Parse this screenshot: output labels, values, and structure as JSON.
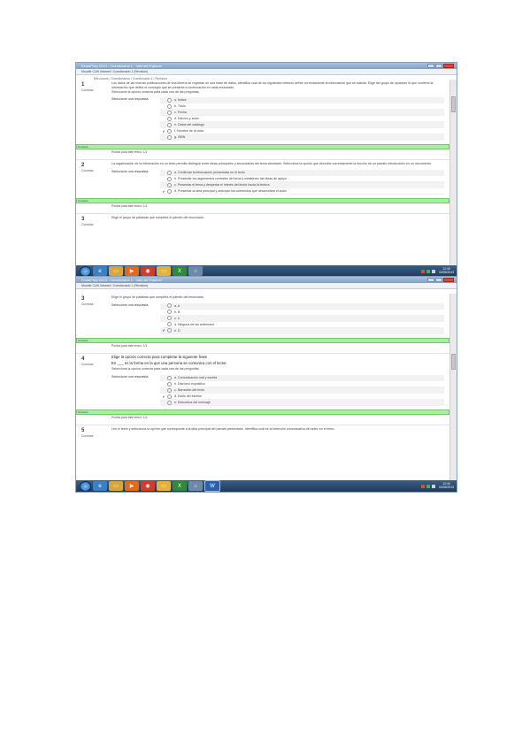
{
  "screens": [
    {
      "window_title": "ExamPrep 2013 - Cuestionario 1 - Internet Explorer",
      "address": "Moodle CUN Intranet / Cuestionario 1 (Revisión)",
      "breadcrumb": "Mis cursos / Cuestionarios / Cuestionario 1 / Revisión",
      "scroll": 0.1,
      "questions": [
        {
          "number": "1",
          "status": "Correcta",
          "text": "Los datos de las nuevas publicaciones de una librería se registran en una base de datos, identifica cuál de los siguientes criterios define correctamente la información que se solicita. Elige del grupo de opciones la que contiene la información que define el concepto que se presenta a continuación en cada enunciado.",
          "subtext": "Seleccione la opción correcta para cada una de las preguntas.",
          "answer_label": "Seleccione una respuesta.",
          "options": [
            {
              "mark": "",
              "text": "a. Índice"
            },
            {
              "mark": "",
              "text": "b. Título"
            },
            {
              "mark": "",
              "text": "c. Fecha"
            },
            {
              "mark": "",
              "text": "d. Edición y autor"
            },
            {
              "mark": "",
              "text": "e. Datos del catálogo"
            },
            {
              "mark": "✔",
              "text": "f. Nombre de la obra"
            },
            {
              "mark": "",
              "text": "g. ISBN"
            }
          ],
          "feedback": "Correcto",
          "score": "Puntos para este envío: 1/1."
        },
        {
          "number": "2",
          "status": "Correcta",
          "text": "La organización de la información en un texto permite distinguir entre ideas principales y secundarias del tema abordado. Selecciona la opción que describe correctamente la función de un párrafo introductorio en un documento.",
          "subtext": "",
          "answer_label": "Seleccione una respuesta.",
          "options": [
            {
              "mark": "",
              "text": "a. Confirmar la información presentada en el texto"
            },
            {
              "mark": "",
              "text": "b. Presentar los argumentos centrales del tema y establecer las ideas de apoyo"
            },
            {
              "mark": "",
              "text": "c. Presentar el tema y despertar el interés del lector hacia la lectura"
            },
            {
              "mark": "✔",
              "text": "d. Presentar la idea principal y anticipar los contenidos que desarrollará el autor"
            }
          ],
          "feedback": "Correcto",
          "score": "Puntos para este envío: 1/1."
        },
        {
          "number": "3",
          "status": "Correcta",
          "text": "Elige el grupo de palabras que completa el párrafo del enunciado.",
          "subtext": "",
          "answer_label": "",
          "options": [],
          "feedback": "",
          "score": ""
        }
      ]
    },
    {
      "window_title": "ExamPrep 2013 - Cuestionario 1 - Internet Explorer",
      "address": "Moodle CUN Intranet / Cuestionario 1 (Revisión)",
      "breadcrumb": "",
      "scroll": 0.35,
      "questions": [
        {
          "number": "3",
          "status": "Correcta",
          "text": "Elige el grupo de palabras que completa el párrafo del enunciado.",
          "subtext": "",
          "answer_label": "Seleccione una respuesta.",
          "options": [
            {
              "mark": "",
              "text": "a. A"
            },
            {
              "mark": "",
              "text": "b. B"
            },
            {
              "mark": "",
              "text": "c. C"
            },
            {
              "mark": "",
              "text": "d. Ninguna de las anteriores"
            },
            {
              "mark": "✔",
              "text": "e. D"
            }
          ],
          "feedback": "Correcto",
          "score": "Puntos para este envío: 1/1."
        },
        {
          "number": "4",
          "status": "Correcta",
          "text": "Elige la opción correcta para completar la siguiente frase",
          "subtext": "En ___ es la forma en la que una persona se comunica con el lector.",
          "subtext2": "Seleccione la opción correcta para cada una de las preguntas.",
          "answer_label": "Seleccione una respuesta.",
          "options": [
            {
              "mark": "",
              "text": "a. Comunicación oral y escrita"
            },
            {
              "mark": "",
              "text": "b. Discurso expositivo"
            },
            {
              "mark": "",
              "text": "c. Narración del texto"
            },
            {
              "mark": "✔",
              "text": "d. Estilo del escritor"
            },
            {
              "mark": "",
              "text": "e. Estructura del mensaje"
            }
          ],
          "feedback": "Correcto",
          "score": "Puntos para este envío: 1/1."
        },
        {
          "number": "5",
          "status": "Correcta",
          "text": "Lee el texto y selecciona la opción que corresponde a la idea principal del párrafo presentado. Identifica cuál es la intención comunicativa del autor en el texto.",
          "subtext": "",
          "answer_label": "",
          "options": [],
          "feedback": "",
          "score": ""
        }
      ]
    }
  ],
  "taskbar": {
    "apps": [
      "ie-icon",
      "explorer-folder-icon",
      "media-player-icon",
      "chrome-icon",
      "folder-icon",
      "excel-icon",
      "network-icon",
      "word-icon"
    ],
    "time": "12:40",
    "date": "03/05/2013"
  },
  "colors": {
    "feedback_bg": "#a6f0a0",
    "titlebar": "#8fb0d4",
    "taskbar": "#2b4a6e"
  }
}
